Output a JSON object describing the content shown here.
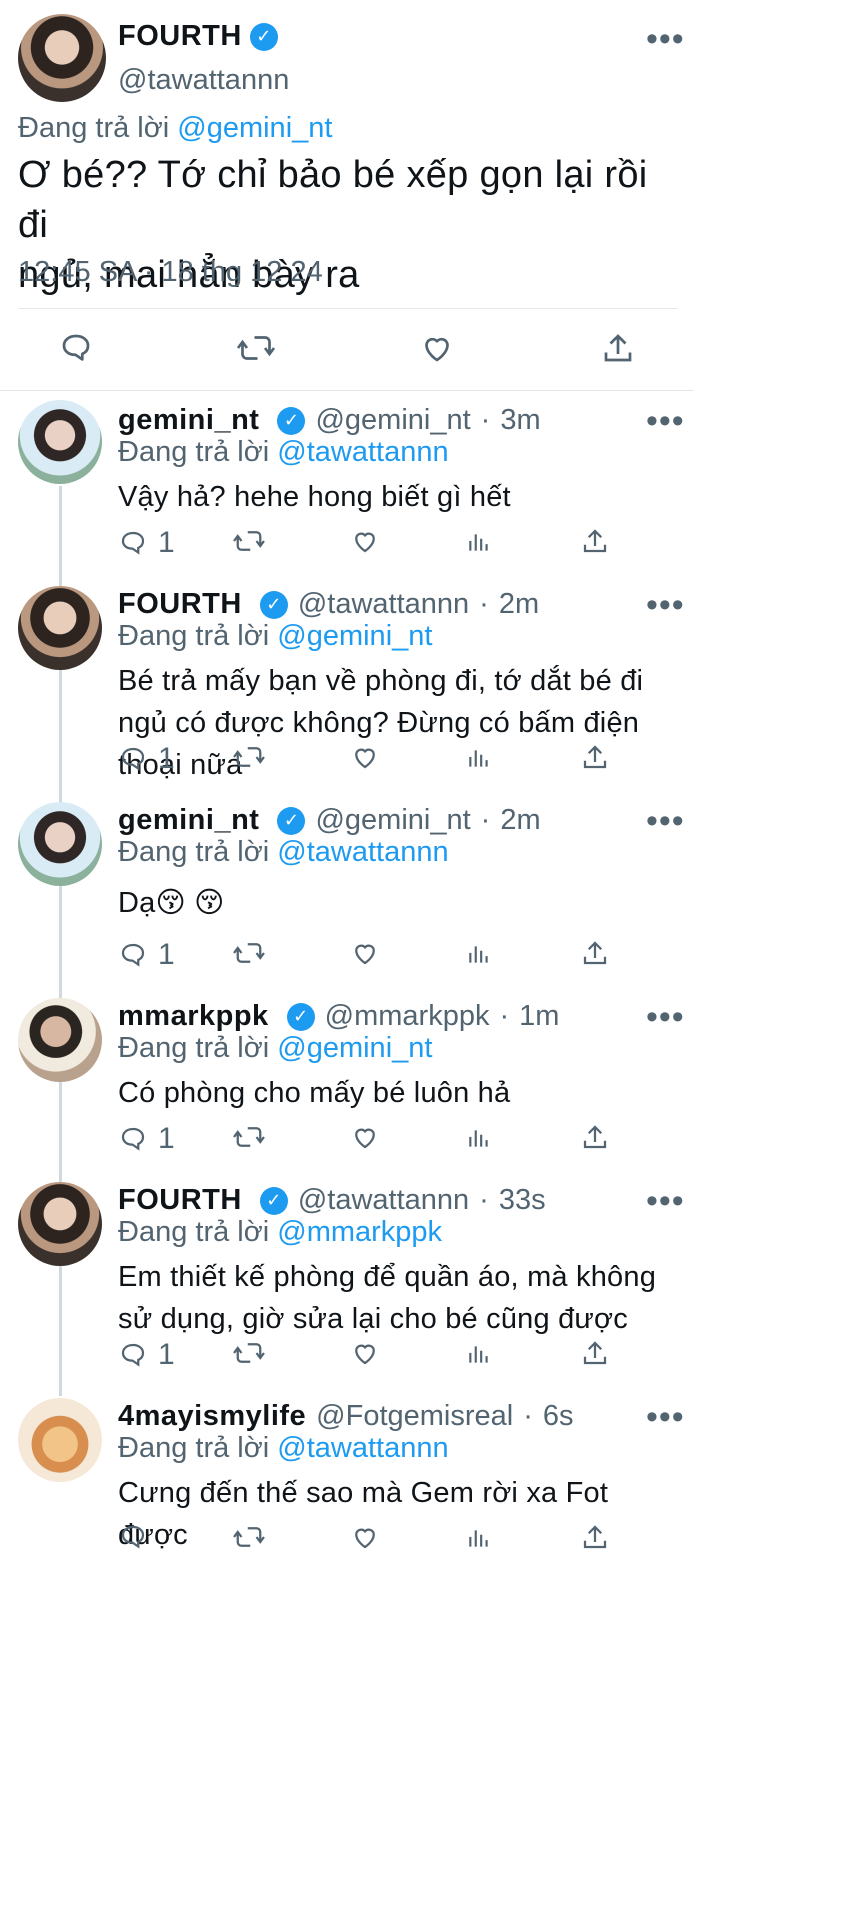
{
  "main_tweet": {
    "name": "FOURTH",
    "handle": "@tawattannn",
    "reply_prefix": "Đang trả lời",
    "reply_to": "@gemini_nt",
    "text_line1": "Ơ bé?? Tớ chỉ bảo bé xếp gọn lại rồi đi",
    "text_line2": "ngủ, mai hẳn bày ra",
    "timestamp": "12:45 SA · 18 thg 12 24"
  },
  "replies": [
    {
      "name": "gemini_nt",
      "handle": "@gemini_nt",
      "time": "3m",
      "reply_prefix": "Đang trả lời",
      "reply_to": "@tawattannn",
      "text": "Vậy hả? hehe hong biết gì hết",
      "reply_count": "1"
    },
    {
      "name": "FOURTH",
      "handle": "@tawattannn",
      "time": "2m",
      "reply_prefix": "Đang trả lời",
      "reply_to": "@gemini_nt",
      "text": "Bé trả mấy bạn về phòng đi, tớ dắt bé đi ngủ có được không? Đừng có bấm điện thoại nữa",
      "reply_count": "1"
    },
    {
      "name": "gemini_nt",
      "handle": "@gemini_nt",
      "time": "2m",
      "reply_prefix": "Đang trả lời",
      "reply_to": "@tawattannn",
      "text": "Dạ😚 😚",
      "reply_count": "1"
    },
    {
      "name": "mmarkppk",
      "handle": "@mmarkppk",
      "time": "1m",
      "reply_prefix": "Đang trả lời",
      "reply_to": "@gemini_nt",
      "text": "Có phòng cho mấy bé luôn hả",
      "reply_count": "1"
    },
    {
      "name": "FOURTH",
      "handle": "@tawattannn",
      "time": "33s",
      "reply_prefix": "Đang trả lời",
      "reply_to": "@mmarkppk",
      "text": "Em thiết kế phòng để quần áo, mà không sử dụng, giờ sửa lại cho bé cũng được",
      "reply_count": "1"
    },
    {
      "name": "4mayismylife",
      "handle": "@Fotgemisreal",
      "time": "6s",
      "reply_prefix": "Đang trả lời",
      "reply_to": "@tawattannn",
      "text": "Cưng đến thế sao mà Gem rời xa Fot được",
      "reply_count": ""
    }
  ],
  "colors": {
    "accent": "#1d9bf0",
    "muted": "#536471",
    "text": "#0f1419"
  },
  "icons": {
    "verified": "verified-badge-icon",
    "reply": "reply-icon",
    "retweet": "retweet-icon",
    "like": "heart-icon",
    "views": "views-icon",
    "share": "share-icon",
    "more": "more-icon"
  }
}
